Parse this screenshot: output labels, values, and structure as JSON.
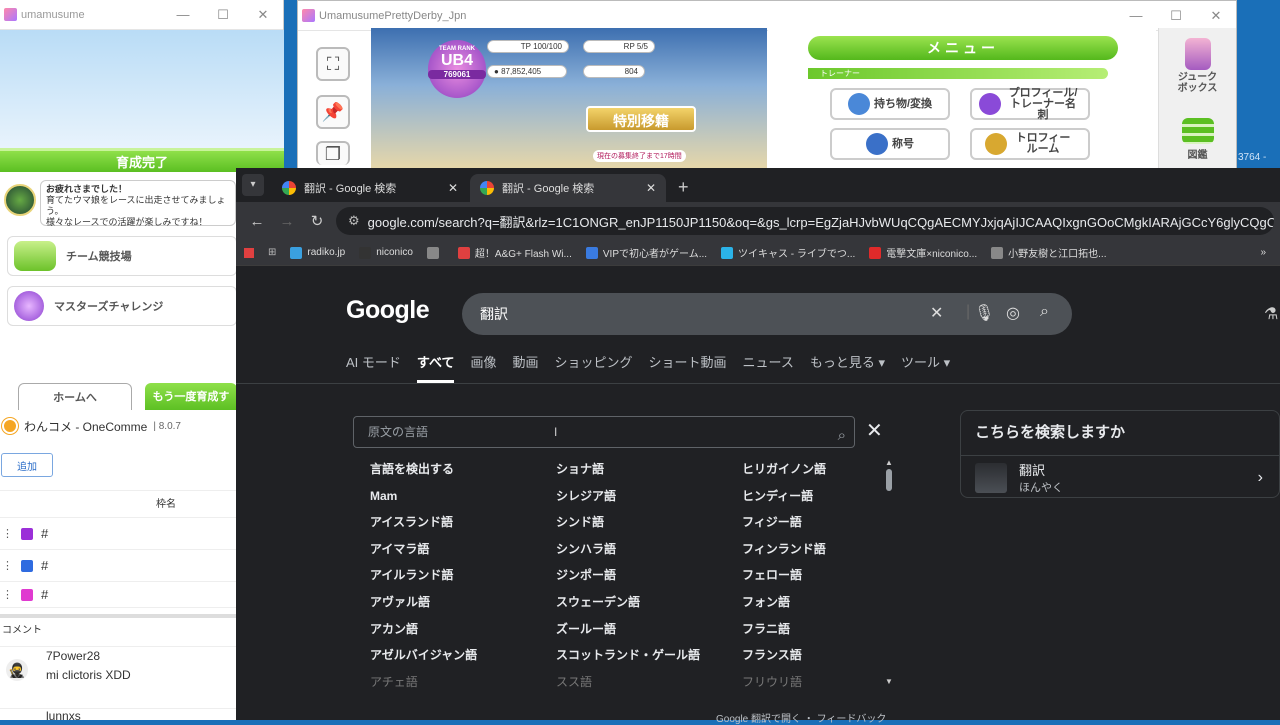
{
  "uma_small": {
    "title": "umamusume",
    "ikusei": "育成完了",
    "talk_lines": [
      "お疲れさまでした！",
      "育てたウマ娘をレースに出走させてみましょう。",
      "様々なレースでの活躍が楽しみですね！"
    ],
    "btn_team": "チーム競技場",
    "btn_master": "マスターズチャレンジ",
    "btn_home": "ホームへ",
    "btn_again": "もう一度育成す"
  },
  "onecomme": {
    "title": "わんコメ - OneComme",
    "version": "8.0.7",
    "add": "追加",
    "waku_header": "枠名",
    "rows": [
      {
        "name": "#",
        "color": "#9b2fd8"
      },
      {
        "name": "#",
        "color": "#2f6be0"
      },
      {
        "name": "#",
        "color": "#e03ad0"
      }
    ],
    "comment_header": "コメント",
    "comments": [
      {
        "user": "7Power28",
        "text": "mi clictoris XDD"
      },
      {
        "user": "lunnxs",
        "text": ""
      }
    ]
  },
  "uma_main": {
    "title": "UmamusumePrettyDerby_Jpn",
    "team_rank_label": "TEAM RANK",
    "team_rank": "UB4",
    "team_score": "769061",
    "tp": "100/100",
    "rp": "5/5",
    "money": "87,852,405",
    "jewels": "804",
    "special": "特別移籍",
    "special_sub": "現在の募集終了まで17時間",
    "menu": "メニュー",
    "trainer": "トレーナー",
    "btn_items": "持ち物/変換",
    "btn_profile": "プロフィール/トレーナー名刺",
    "btn_title": "称号",
    "btn_trophy": "トロフィールーム",
    "jukebox": "ジュークボックス",
    "zukan": "図鑑",
    "bg_num": "3764 -"
  },
  "chrome": {
    "tabs": [
      {
        "title": "翻訳 - Google 検索"
      },
      {
        "title": "翻訳 - Google 検索"
      }
    ],
    "url": "google.com/search?q=翻訳&rlz=1C1ONGR_enJP1150JP1150&oq=&gs_lcrp=EgZjaHJvbWUqCQgAECMYJxjqAjIJCAAQIxgnGOoCMgkIARAjGCcY6glyCQgCECMYJxjqAjIJCAMQIx...",
    "bookmarks": [
      {
        "label": "radiko.jp",
        "color": "#3aa0e0"
      },
      {
        "label": "niconico",
        "color": "#333333"
      },
      {
        "label": "",
        "color": "#888888"
      },
      {
        "label": "超！A&G+ Flash Wi...",
        "color": "#e04040"
      },
      {
        "label": "VIPで初心者がゲーム...",
        "color": "#3a7be0"
      },
      {
        "label": "ツイキャス - ライブでつ...",
        "color": "#2bb3e8"
      },
      {
        "label": "電撃文庫×niconico...",
        "color": "#e02a2a"
      },
      {
        "label": "小野友樹と江口拓也...",
        "color": "#888888"
      }
    ],
    "logo": "Google",
    "query": "翻訳",
    "gtabs": [
      "AI モード",
      "すべて",
      "画像",
      "動画",
      "ショッピング",
      "ショート動画",
      "ニュース",
      "もっと見る ▾",
      "ツール ▾"
    ],
    "src_placeholder": "原文の言語",
    "col1": [
      "言語を検出する",
      "Mam",
      "アイスランド語",
      "アイマラ語",
      "アイルランド語",
      "アヴァル語",
      "アカン語",
      "アゼルバイジャン語",
      "アチェ語"
    ],
    "col2": [
      "ショナ語",
      "シレジア語",
      "シンド語",
      "シンハラ語",
      "ジンポー語",
      "スウェーデン語",
      "ズールー語",
      "スコットランド・ゲール語",
      "スス語"
    ],
    "col3": [
      "ヒリガイノン語",
      "ヒンディー語",
      "フィジー語",
      "フィンランド語",
      "フェロー語",
      "フォン語",
      "フラニ語",
      "フランス語",
      "フリウリ語"
    ],
    "side_title": "こちらを検索しますか",
    "side_term": "翻訳",
    "side_reading": "ほんやく",
    "footer": "Google 翻訳で開く ・ フィードバック"
  }
}
